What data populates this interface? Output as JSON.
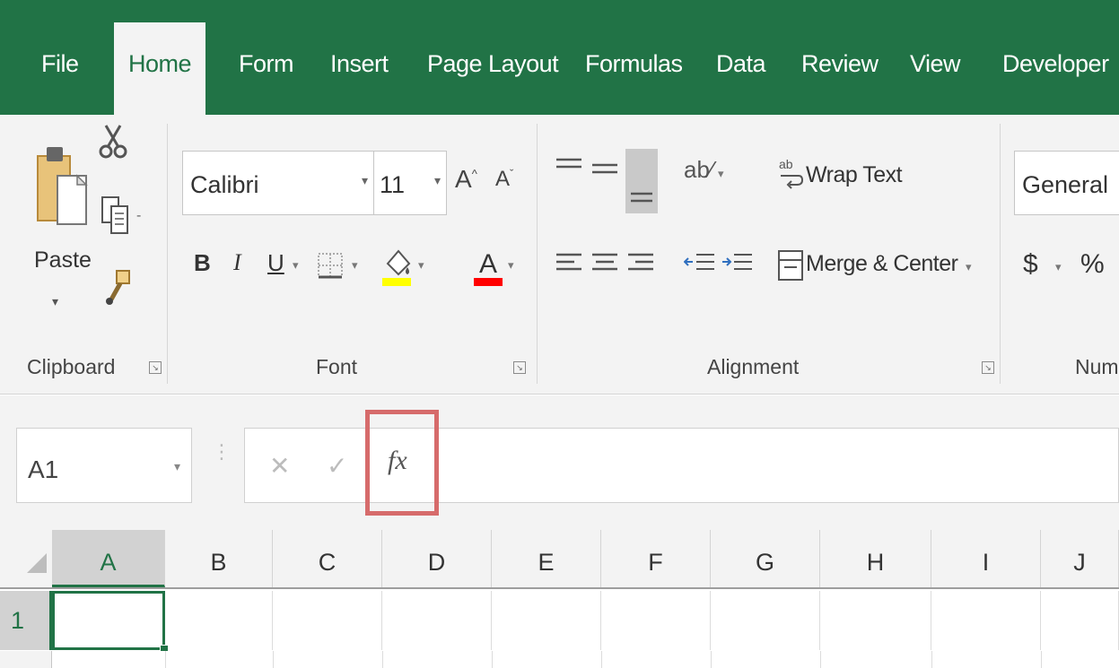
{
  "tabs": [
    "File",
    "Home",
    "Form",
    "Insert",
    "Page Layout",
    "Formulas",
    "Data",
    "Review",
    "View",
    "Developer"
  ],
  "active_tab": "Home",
  "clipboard": {
    "paste_label": "Paste",
    "group_label": "Clipboard"
  },
  "font": {
    "name": "Calibri",
    "size": "11",
    "grow_label": "A",
    "shrink_label": "A",
    "bold_label": "B",
    "italic_label": "I",
    "underline_label": "U",
    "color_letter": "A",
    "group_label": "Font",
    "fill_color": "#ffff00",
    "font_color": "#ff0000"
  },
  "alignment": {
    "wrap_text_label": "Wrap Text",
    "merge_label": "Merge & Center",
    "group_label": "Alignment"
  },
  "number": {
    "format": "General",
    "currency_label": "$",
    "percent_label": "%",
    "group_label": "Num"
  },
  "formula_bar": {
    "name_box": "A1",
    "cancel_label": "✕",
    "enter_label": "✓",
    "fx_label": "fx",
    "formula": ""
  },
  "grid": {
    "columns": [
      "A",
      "B",
      "C",
      "D",
      "E",
      "F",
      "G",
      "H",
      "I",
      "J"
    ],
    "rows": [
      "1"
    ],
    "active_cell": "A1"
  },
  "colors": {
    "accent": "#217346",
    "highlight": "#d66b6b"
  }
}
